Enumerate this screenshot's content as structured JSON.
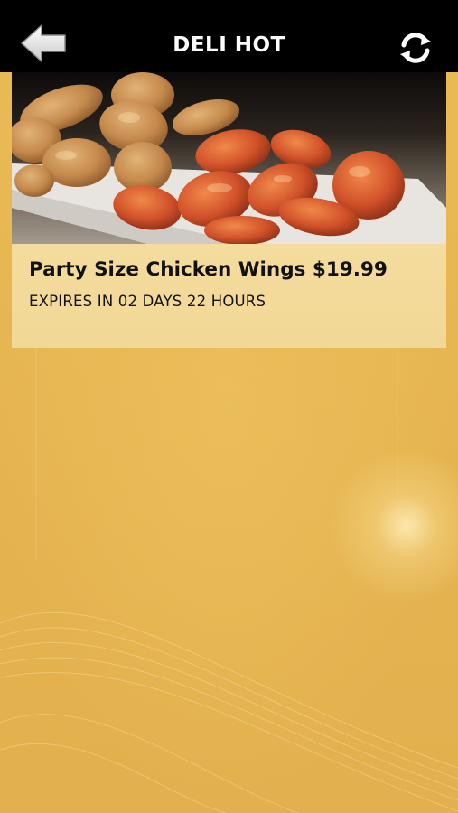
{
  "header": {
    "title": "DELI HOT",
    "back_icon": "back-arrow-icon",
    "refresh_icon": "refresh-icon",
    "background_color": "#000000"
  },
  "deal": {
    "image": "chicken-wings-photo",
    "title": "Party Size Chicken Wings $19.99",
    "expiry": "EXPIRES IN 02 DAYS 22 HOURS"
  },
  "colors": {
    "background": "#e6b652",
    "card_body": "#f3da9a",
    "text": "#111111",
    "header_text": "#ffffff"
  }
}
